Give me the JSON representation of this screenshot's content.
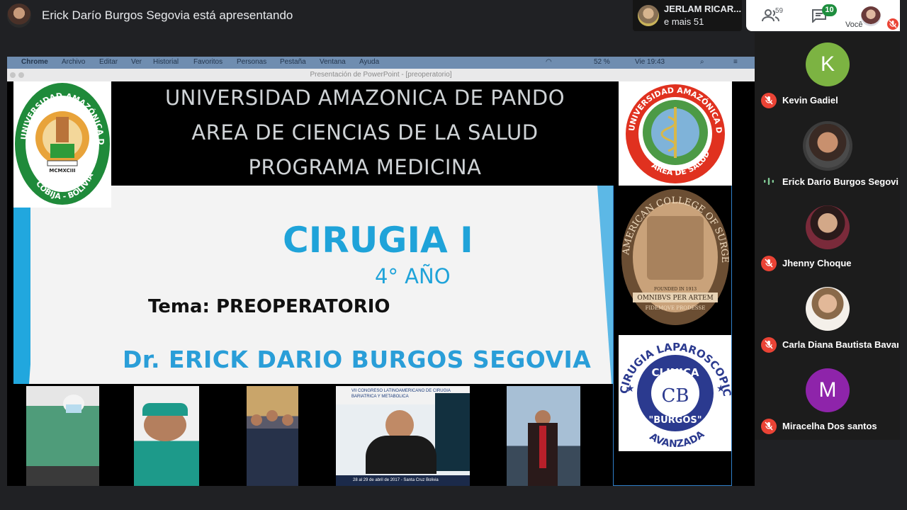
{
  "topbar": {
    "presenting_text": "Erick Darío Burgos Segovia está apresentando",
    "raised_hand_name": "JERLAM RICAR...",
    "raised_hand_more": "e mais 51",
    "people_count": "59",
    "chat_badge": "10",
    "self_label": "Você"
  },
  "screen": {
    "menubar": {
      "items": [
        "Chrome",
        "Archivo",
        "Editar",
        "Ver",
        "Historial",
        "Favoritos",
        "Personas",
        "Pestaña",
        "Ventana",
        "Ayuda"
      ],
      "battery": "52 %",
      "clock": "Vie 19:43"
    },
    "window_title": "Presentación de PowerPoint - [preoperatorio]"
  },
  "slide": {
    "uni_lines": [
      "UNIVERSIDAD AMAZONICA DE PANDO",
      "AREA DE CIENCIAS DE LA SALUD",
      "PROGRAMA MEDICINA"
    ],
    "logo_left": {
      "top_text": "UNIVERSIDAD AMAZÓNICA DE PANDO",
      "roman": "MCMXCIII",
      "bottom_text": "COBIJA - BOLIVIA"
    },
    "logo_salud": {
      "top_text": "UNIVERSIDAD AMAZÓNICA DE PANDO",
      "bottom_text": "ÁREA DE SALUD"
    },
    "logo_acs": {
      "text": "AMERICAN COLLEGE OF SURGEONS",
      "motto": "OMNIBVS PER ARTEM",
      "motto2": "FIDEMQVE PRODESSE",
      "founded": "FOUNDED IN 1913"
    },
    "logo_clinica": {
      "arc_top": "CIRUGIA LAPAROSCOPICA",
      "clinica": "CLINICA",
      "initials": "CB",
      "burgos": "\"BURGOS\"",
      "avanzada": "AVANZADA"
    },
    "course": "CIRUGIA I",
    "year": "4° AÑO",
    "topic": "Tema: PREOPERATORIO",
    "doctor": "Dr. ERICK DARIO BURGOS SEGOVIA",
    "congress_banner": "VII CONGRESO LATINOAMERICANO DE CIRUGIA BARIATRICA Y METABOLICA",
    "congress_footer": "28 al 29 de abril de 2017 - Santa Cruz Bolivia"
  },
  "participants": [
    {
      "name": "Kevin Gadiel",
      "initial": "K",
      "color": "#7cb342",
      "muted": true
    },
    {
      "name": "Erick Darío Burgos Segovia",
      "initial": "",
      "color": "#3c3c3c",
      "muted": false
    },
    {
      "name": "Jhenny Choque",
      "initial": "",
      "color": "#5a3a3a",
      "muted": true
    },
    {
      "name": "Carla Diana Bautista Bavar...",
      "initial": "",
      "color": "#d9c9b0",
      "muted": true
    },
    {
      "name": "Miracelha Dos santos",
      "initial": "M",
      "color": "#8e24aa",
      "muted": true
    }
  ]
}
